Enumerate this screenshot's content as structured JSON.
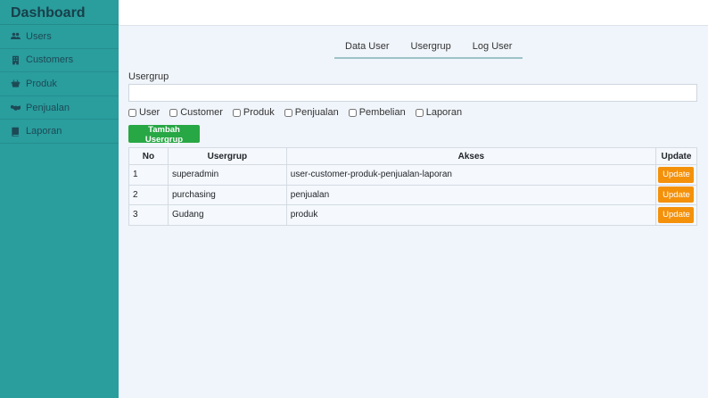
{
  "sidebar": {
    "brand": "Dashboard",
    "items": [
      {
        "label": "Users",
        "icon": "users-icon"
      },
      {
        "label": "Customers",
        "icon": "building-icon"
      },
      {
        "label": "Produk",
        "icon": "basket-icon"
      },
      {
        "label": "Penjualan",
        "icon": "handshake-icon"
      },
      {
        "label": "Laporan",
        "icon": "book-icon"
      }
    ]
  },
  "tabs": [
    "Data User",
    "Usergrup",
    "Log User"
  ],
  "form": {
    "label": "Usergrup",
    "input_value": "",
    "checkboxes": [
      "User",
      "Customer",
      "Produk",
      "Penjualan",
      "Pembelian",
      "Laporan"
    ],
    "add_label": "Tambah Usergrup"
  },
  "table": {
    "headers": [
      "No",
      "Usergrup",
      "Akses",
      "Update"
    ],
    "rows": [
      {
        "no": "1",
        "usergrup": "superadmin",
        "akses": "user-customer-produk-penjualan-laporan",
        "update": "Update"
      },
      {
        "no": "2",
        "usergrup": "purchasing",
        "akses": "penjualan",
        "update": "Update"
      },
      {
        "no": "3",
        "usergrup": "Gudang",
        "akses": "produk",
        "update": "Update"
      }
    ]
  },
  "colors": {
    "sidebar": "#2a9d9d",
    "add_button": "#28a745",
    "update_button": "#f4910b"
  }
}
